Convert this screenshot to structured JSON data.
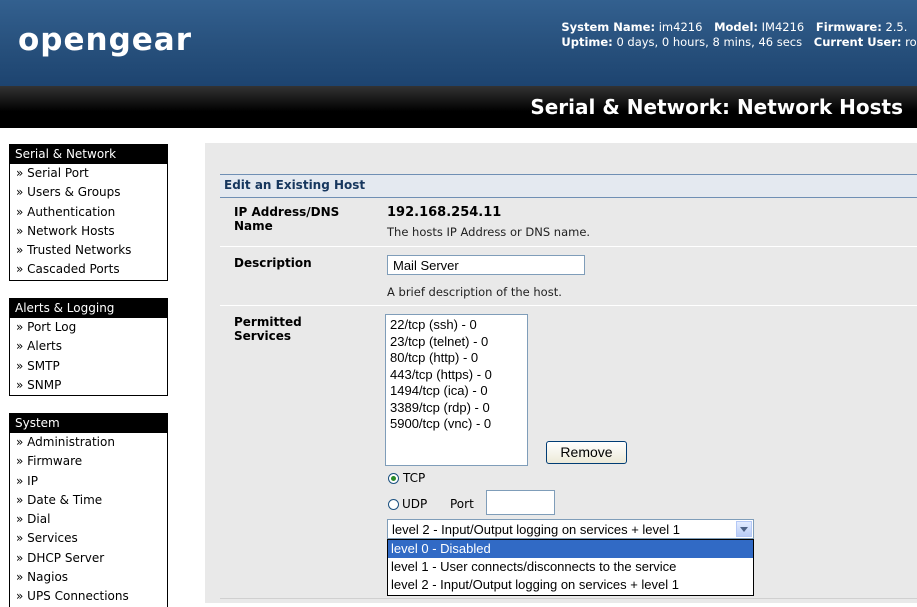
{
  "header": {
    "logo": "opengear",
    "system_name_label": "System Name:",
    "system_name": "im4216",
    "model_label": "Model:",
    "model": "IM4216",
    "firmware_label": "Firmware:",
    "firmware": "2.5.",
    "uptime_label": "Uptime:",
    "uptime": "0 days, 0 hours, 8 mins, 46 secs",
    "user_label": "Current User:",
    "user": "roc",
    "page_title": "Serial & Network: Network Hosts"
  },
  "sidebar": {
    "serial": {
      "heading": "Serial & Network",
      "items": [
        "Serial Port",
        "Users & Groups",
        "Authentication",
        "Network Hosts",
        "Trusted Networks",
        "Cascaded Ports"
      ]
    },
    "alerts": {
      "heading": "Alerts & Logging",
      "items": [
        "Port Log",
        "Alerts",
        "SMTP",
        "SNMP"
      ]
    },
    "system": {
      "heading": "System",
      "items": [
        "Administration",
        "Firmware",
        "IP",
        "Date & Time",
        "Dial",
        "Services",
        "DHCP Server",
        "Nagios",
        "UPS Connections"
      ]
    }
  },
  "form": {
    "section_title": "Edit an Existing Host",
    "ip_label": "IP Address/DNS Name",
    "ip_value": "192.168.254.11",
    "ip_hint": "The hosts IP Address or DNS name.",
    "desc_label": "Description",
    "desc_value": "Mail Server",
    "desc_hint": "A brief description of the host.",
    "services_label": "Permitted Services",
    "services": [
      "22/tcp (ssh) - 0",
      "23/tcp (telnet) - 0",
      "80/tcp (http) - 0",
      "443/tcp (https) - 0",
      "1494/tcp (ica) - 0",
      "3389/tcp (rdp) - 0",
      "5900/tcp (vnc) - 0"
    ],
    "remove_button": "Remove",
    "tcp_label": "TCP",
    "udp_label": "UDP",
    "port_label": "Port",
    "port_value": "",
    "protocol_selected": "TCP",
    "logging_selected": "level 2 - Input/Output logging on services + level 1",
    "logging_options": [
      "level 0 - Disabled",
      "level 1 - User connects/disconnects to the service",
      "level 2 - Input/Output logging on services + level 1"
    ],
    "logging_highlighted": "level 0 - Disabled"
  },
  "colors": {
    "header_blue": "#27507c",
    "section_text": "#17375e",
    "selection_blue": "#316ac5",
    "panel_bg": "#e9e9e9"
  }
}
